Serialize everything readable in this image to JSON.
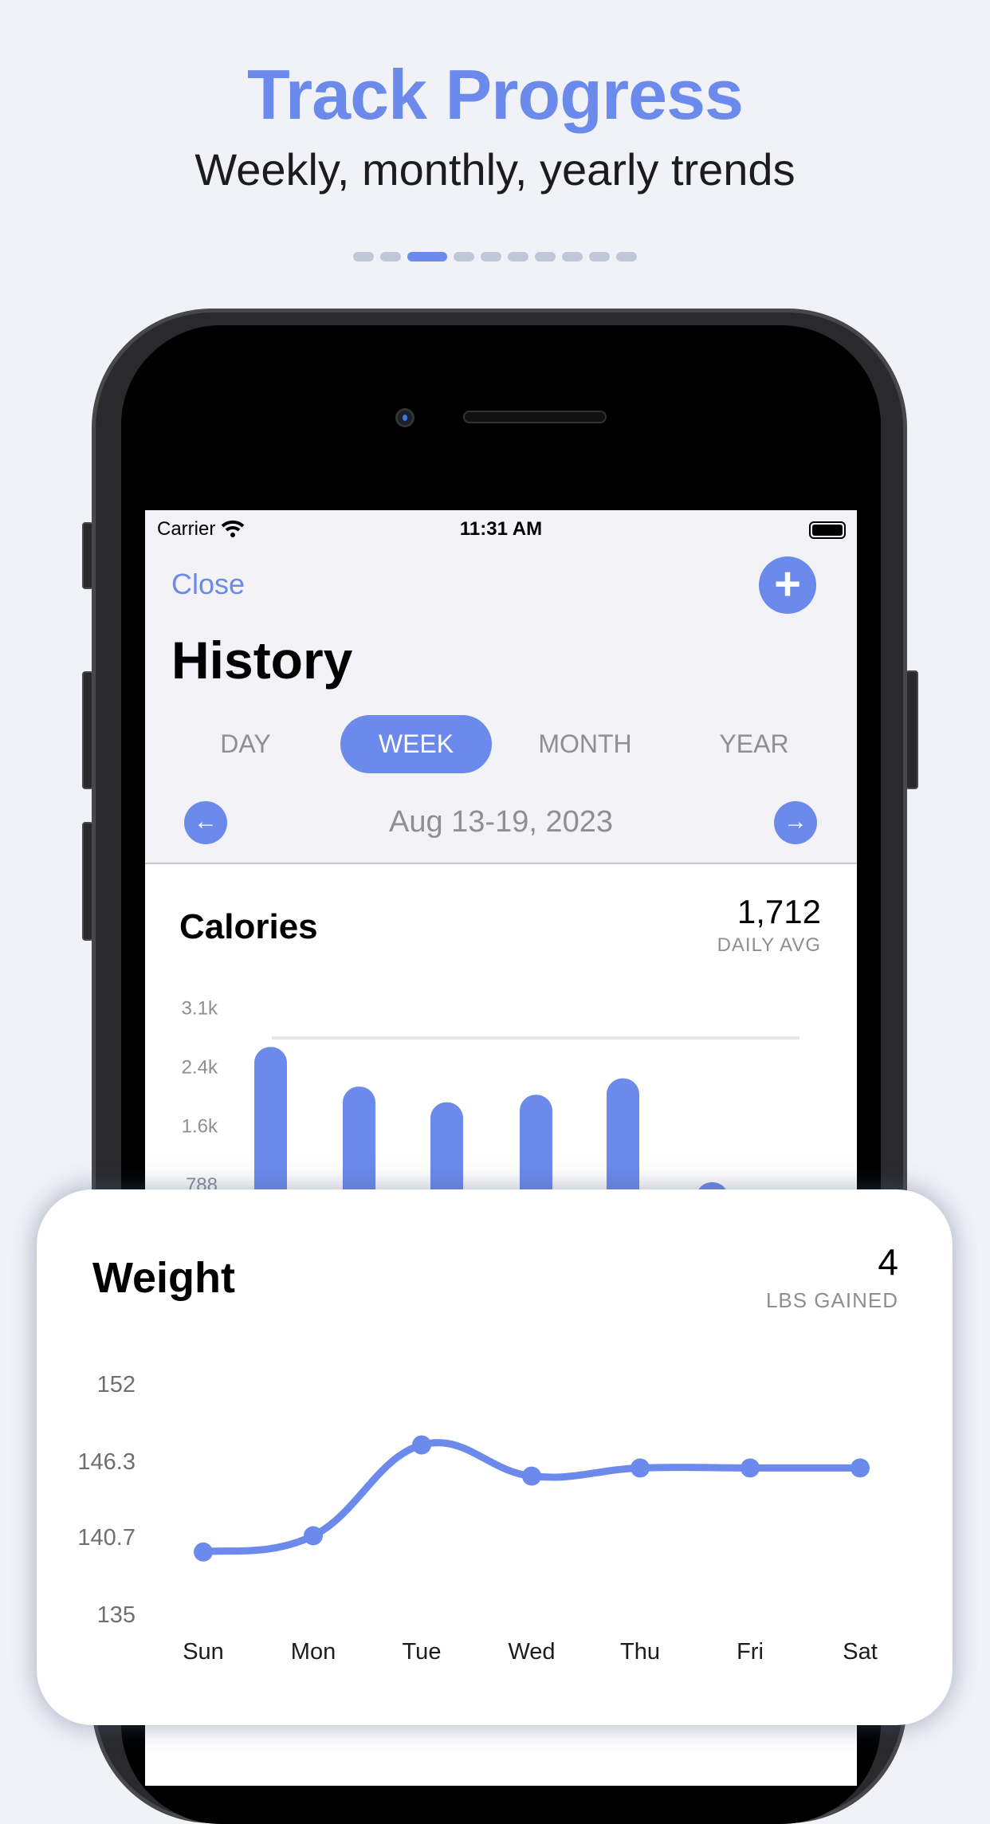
{
  "promo": {
    "headline": "Track Progress",
    "subheadline": "Weekly, monthly, yearly trends",
    "page_count": 10,
    "active_page": 3
  },
  "colors": {
    "accent": "#6b8aeb",
    "background": "#f0f2f7",
    "goal_line": "#e5e5ea"
  },
  "status_bar": {
    "carrier": "Carrier",
    "time": "11:31 AM",
    "wifi_icon": "wifi-icon",
    "battery_icon": "battery-icon"
  },
  "nav": {
    "close_label": "Close",
    "add_icon": "+",
    "title": "History"
  },
  "segments": [
    {
      "label": "DAY",
      "active": false
    },
    {
      "label": "WEEK",
      "active": true
    },
    {
      "label": "MONTH",
      "active": false
    },
    {
      "label": "YEAR",
      "active": false
    }
  ],
  "date_nav": {
    "prev_icon": "←",
    "range": "Aug 13-19, 2023",
    "next_icon": "→"
  },
  "calories": {
    "title": "Calories",
    "value": "1,712",
    "caption": "DAILY AVG"
  },
  "weight": {
    "title": "Weight",
    "value": "4",
    "caption": "LBS GAINED"
  },
  "chart_data": [
    {
      "type": "bar",
      "title": "Calories",
      "categories": [
        "Sun",
        "Mon",
        "Tue",
        "Wed",
        "Thu",
        "Fri",
        "Sat"
      ],
      "values": [
        2620,
        2090,
        1880,
        1980,
        2200,
        810,
        0
      ],
      "ytick_labels": [
        "3.1k",
        "2.4k",
        "1.6k",
        "788"
      ],
      "yticks": [
        3150,
        2363,
        1575,
        788
      ],
      "goal_line": 2740,
      "ylim": [
        0,
        3150
      ],
      "grid": false
    },
    {
      "type": "line",
      "title": "Weight",
      "categories": [
        "Sun",
        "Mon",
        "Tue",
        "Wed",
        "Thu",
        "Fri",
        "Sat"
      ],
      "values": [
        139.6,
        140.8,
        147.5,
        145.2,
        145.8,
        145.8,
        145.8
      ],
      "ytick_labels": [
        "152",
        "146.3",
        "140.7",
        "135"
      ],
      "yticks": [
        152,
        146.3,
        140.7,
        135
      ],
      "ylim": [
        135,
        152
      ],
      "smooth": true,
      "grid": false
    }
  ]
}
